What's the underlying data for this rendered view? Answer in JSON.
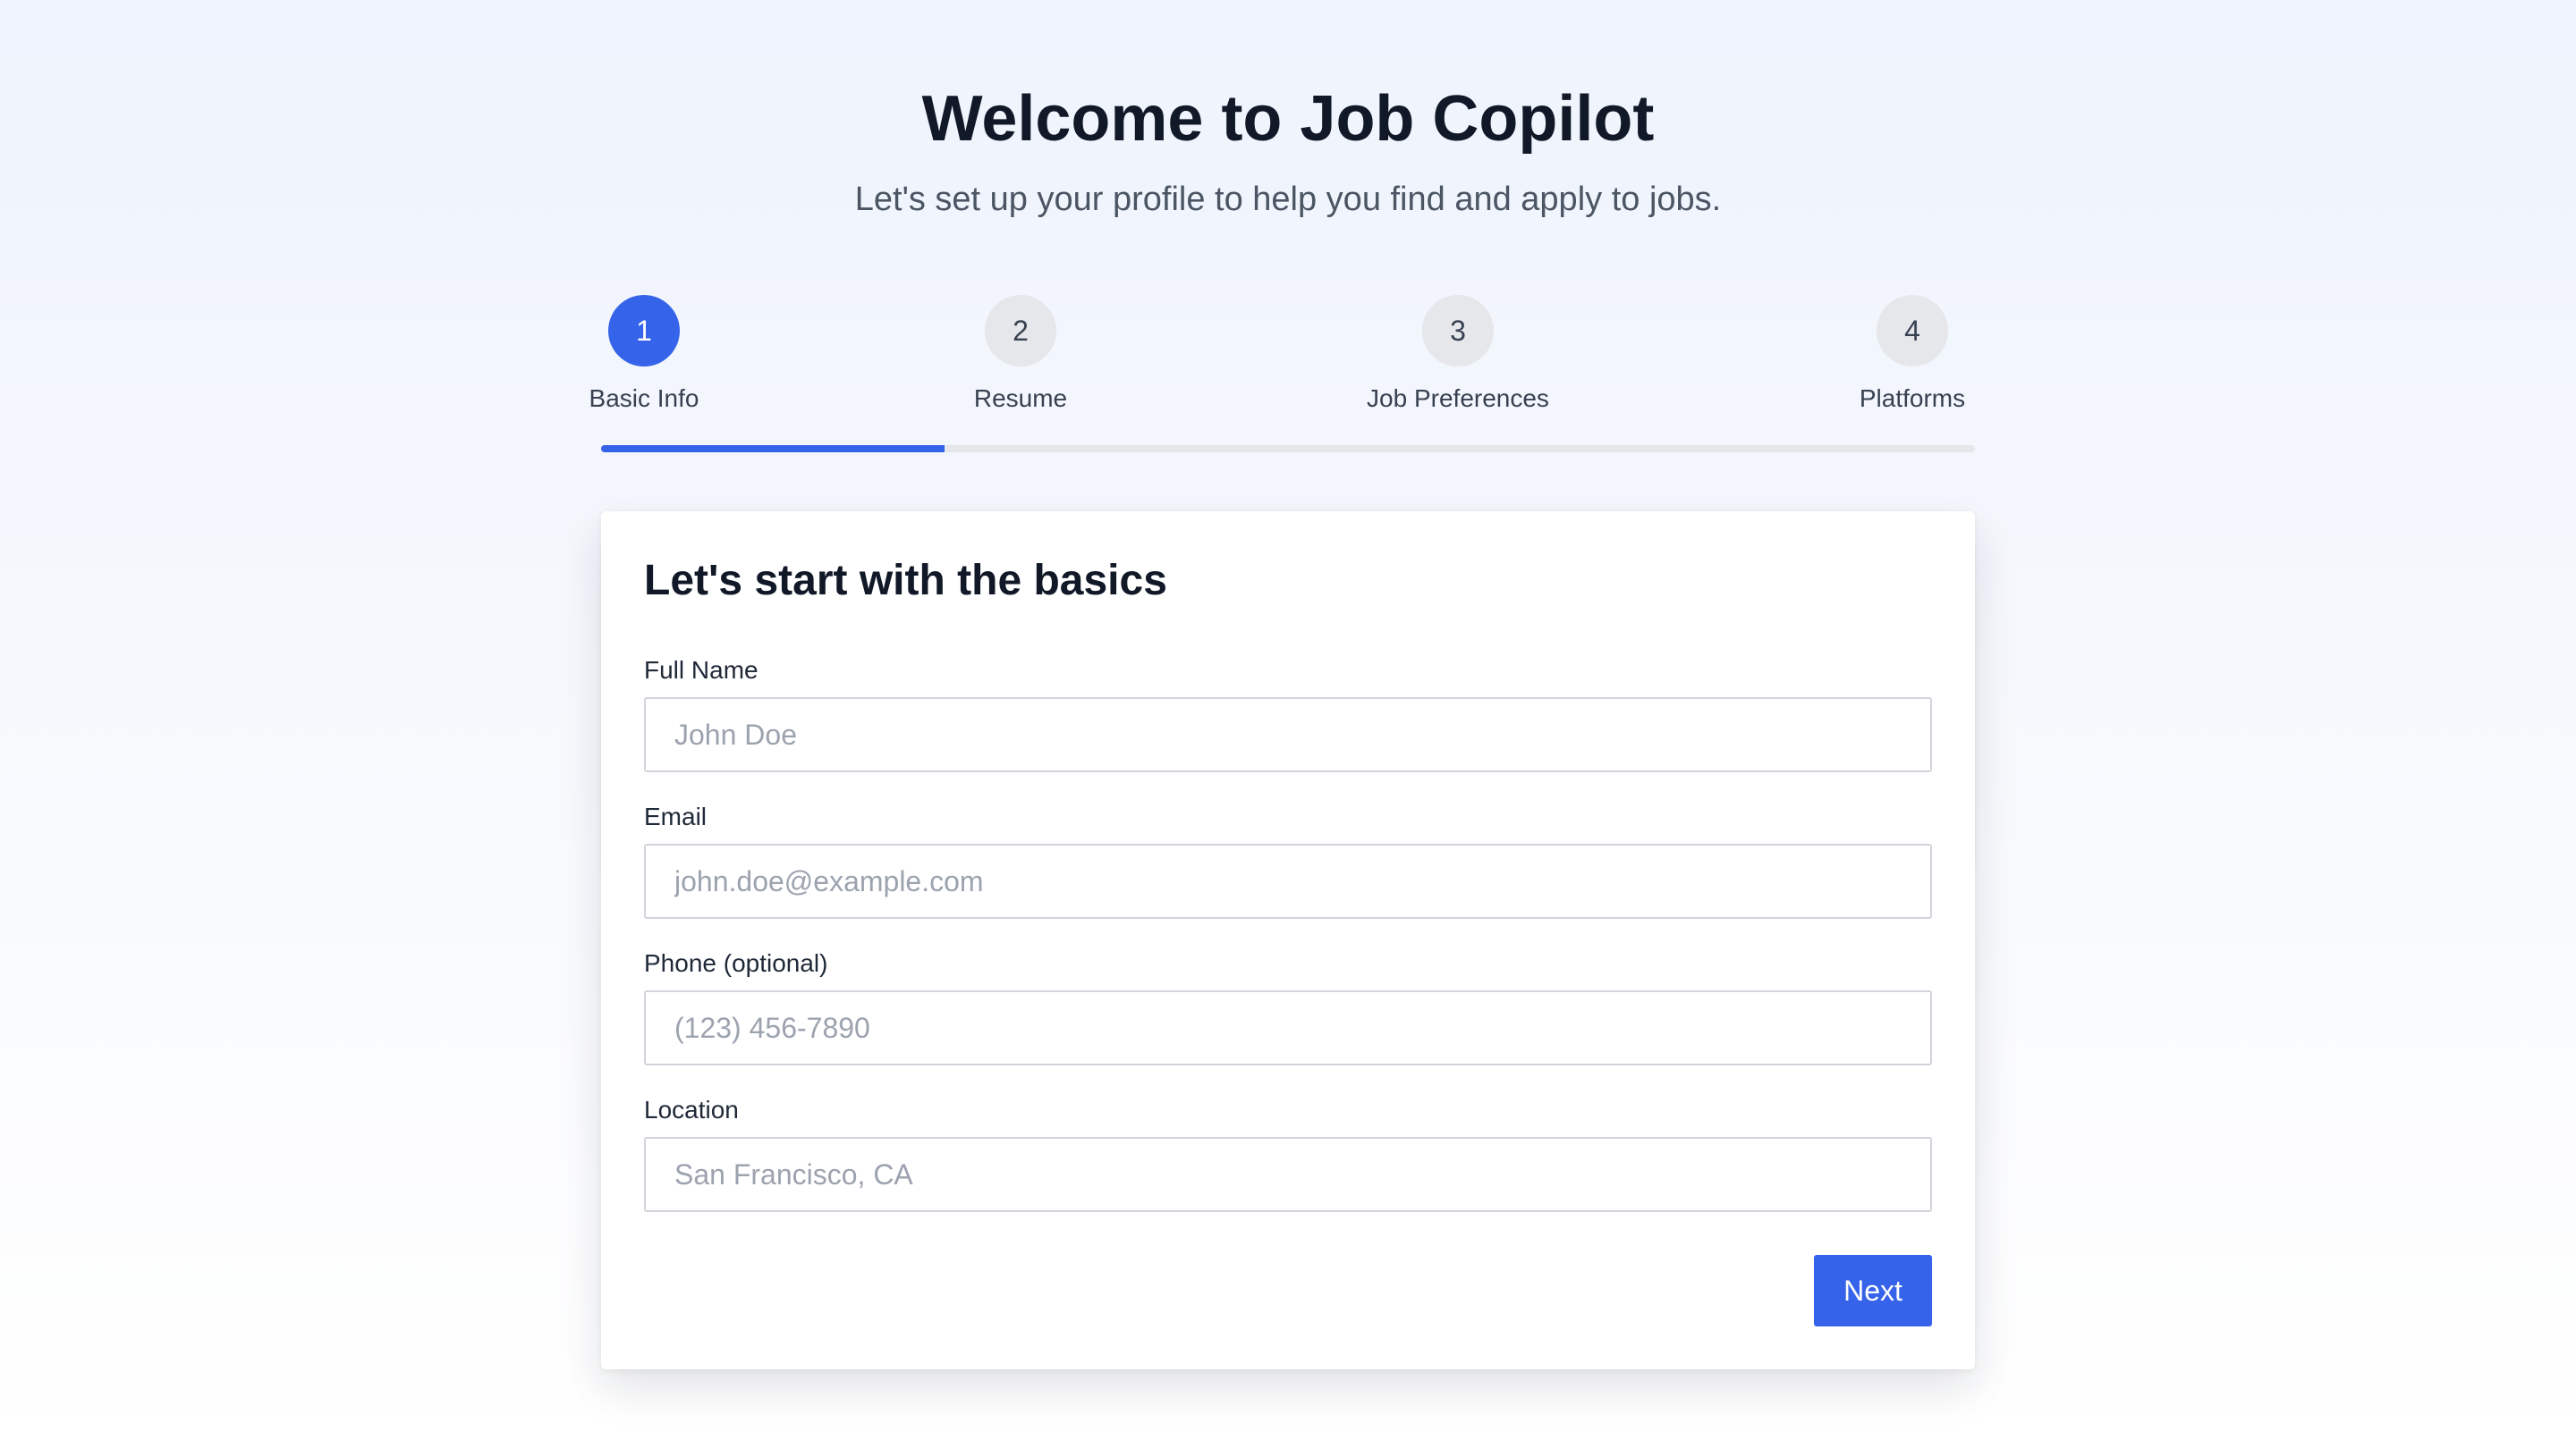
{
  "header": {
    "title": "Welcome to Job Copilot",
    "subtitle": "Let's set up your profile to help you find and apply to jobs."
  },
  "stepper": {
    "current_step": 1,
    "progress_percent": 25,
    "steps": [
      {
        "number": "1",
        "label": "Basic Info",
        "active": true
      },
      {
        "number": "2",
        "label": "Resume",
        "active": false
      },
      {
        "number": "3",
        "label": "Job Preferences",
        "active": false
      },
      {
        "number": "4",
        "label": "Platforms",
        "active": false
      }
    ]
  },
  "form": {
    "heading": "Let's start with the basics",
    "fields": [
      {
        "label": "Full Name",
        "value": "",
        "placeholder": "John Doe"
      },
      {
        "label": "Email",
        "value": "",
        "placeholder": "john.doe@example.com"
      },
      {
        "label": "Phone (optional)",
        "value": "",
        "placeholder": "(123) 456-7890"
      },
      {
        "label": "Location",
        "value": "",
        "placeholder": "San Francisco, CA"
      }
    ],
    "next_label": "Next"
  },
  "colors": {
    "accent": "#3563e9",
    "inactive_step": "#e5e7eb",
    "text_primary": "#111827",
    "text_secondary": "#4b5563"
  }
}
